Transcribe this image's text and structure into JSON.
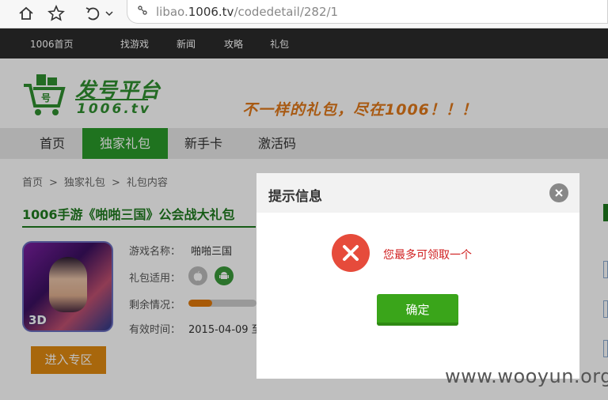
{
  "browser": {
    "url_prefix": "libao.",
    "url_domain": "1006.tv",
    "url_path": "/codedetail/282/1"
  },
  "topnav": {
    "items": [
      "1006首页",
      "找游戏",
      "新闻",
      "攻略",
      "礼包"
    ]
  },
  "header": {
    "logo_title": "发号平台",
    "logo_sub": "1006.tv",
    "logo_cart_text": "号",
    "slogan": "不一样的礼包，尽在1006！！！"
  },
  "mainnav": {
    "items": [
      "首页",
      "独家礼包",
      "新手卡",
      "激活码"
    ],
    "active_index": 1,
    "active_color": "#2a9a2a"
  },
  "breadcrumb": {
    "items": [
      "首页",
      "独家礼包",
      "礼包内容"
    ],
    "separator": ">"
  },
  "gift": {
    "title": "1006手游《啪啪三国》公会战大礼包",
    "icon_badge": "3D",
    "labels": {
      "game_name": "游戏名称：",
      "platform": "礼包适用：",
      "remaining": "剩余情况：",
      "valid_time": "有效时间："
    },
    "game_name": "啪啪三国",
    "platforms": [
      "apple-icon",
      "android-icon"
    ],
    "remaining_fraction": 0.35,
    "valid_time": "2015-04-09 至",
    "enter_button": "进入专区"
  },
  "dialog": {
    "title": "提示信息",
    "message": "您最多可领取一个",
    "ok_label": "确定"
  },
  "watermark": "www.wooyun.org",
  "colors": {
    "accent_green": "#2a9a2a",
    "error_red": "#e64b3b",
    "ok_green": "#3aa51a",
    "orange": "#e08a10"
  }
}
